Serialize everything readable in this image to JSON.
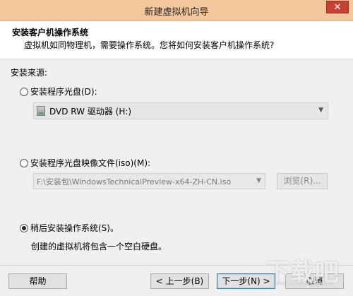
{
  "window": {
    "title": "新建虚拟机向导",
    "close_symbol": "✕"
  },
  "header": {
    "title": "安装客户机操作系统",
    "description": "虚拟机如同物理机，需要操作系统。您将如何安装客户机操作系统?"
  },
  "source": {
    "label": "安装来源:",
    "options": [
      {
        "label": "安装程序光盘(D):",
        "checked": false
      },
      {
        "label": "安装程序光盘映像文件(iso)(M):",
        "checked": false
      },
      {
        "label": "稍后安装操作系统(S)。",
        "checked": true
      }
    ],
    "disc_select": {
      "value": "DVD RW 驱动器 (H:)",
      "icon": "dvd-drive-icon"
    },
    "iso_path": {
      "value": "F:\\安装包\\WindowsTechnicalPreview-x64-ZH-CN.iso"
    },
    "browse_label": "浏览(R)...",
    "later_hint": "创建的虚拟机将包含一个空白硬盘。"
  },
  "footer": {
    "help": "帮助",
    "back": "< 上一步(B)",
    "next": "下一步(N) >",
    "cancel": "取消"
  },
  "watermark": {
    "text": "下载吧",
    "url": "www.xiazaiba.com"
  },
  "colors": {
    "titlebar": "#f2c79b",
    "close": "#c74234",
    "primary_border": "#3c7fb1"
  }
}
